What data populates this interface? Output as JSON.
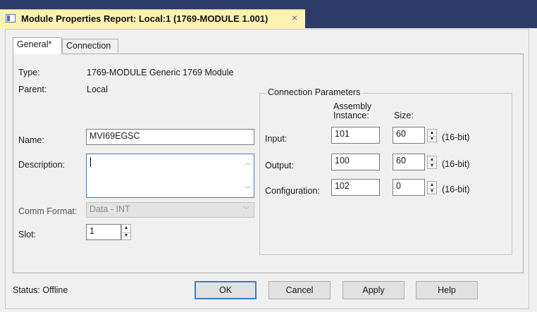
{
  "window": {
    "tab_title": "Module Properties Report: Local:1 (1769-MODULE 1.001)",
    "close_glyph": "×"
  },
  "tabs": [
    "General*",
    "Connection"
  ],
  "general": {
    "type_label": "Type:",
    "type_value": "1769-MODULE Generic 1769 Module",
    "parent_label": "Parent:",
    "parent_value": "Local",
    "name_label": "Name:",
    "name_value": "MVI69EGSC",
    "description_label": "Description:",
    "description_value": "",
    "comm_format_label": "Comm Format:",
    "comm_format_value": "Data - INT",
    "slot_label": "Slot:",
    "slot_value": "1"
  },
  "connection_parameters": {
    "title": "Connection Parameters",
    "assembly_header": [
      "Assembly",
      "Instance:"
    ],
    "size_header": "Size:",
    "rows": [
      {
        "label": "Input:",
        "instance": "101",
        "size": "60",
        "unit": "(16-bit)"
      },
      {
        "label": "Output:",
        "instance": "100",
        "size": "60",
        "unit": "(16-bit)"
      },
      {
        "label": "Configuration:",
        "instance": "102",
        "size": "0",
        "unit": "(16-bit)"
      }
    ]
  },
  "footer": {
    "status": "Status:  Offline",
    "buttons": [
      "OK",
      "Cancel",
      "Apply",
      "Help"
    ]
  },
  "colors": {
    "titlebar": "#2b3a67",
    "active_tab": "#fdf2b2",
    "default_button_border": "#3c7fc1"
  }
}
